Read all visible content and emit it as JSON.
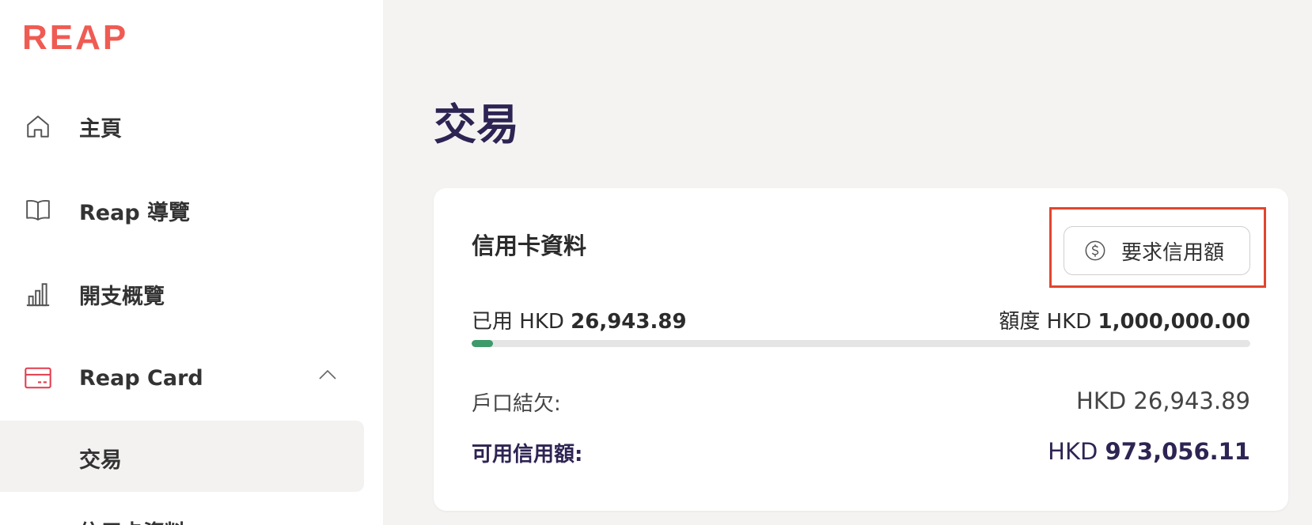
{
  "brand": {
    "logo_text": "REAP",
    "accent_color": "#ef5b52",
    "title_color": "#2e2453"
  },
  "sidebar": {
    "items": [
      {
        "label": "主頁",
        "icon": "home-icon"
      },
      {
        "label": "Reap 導覽",
        "icon": "book-icon"
      },
      {
        "label": "開支概覽",
        "icon": "bar-chart-icon"
      },
      {
        "label": "Reap Card",
        "icon": "credit-card-icon",
        "expanded": true
      }
    ],
    "subitems": [
      {
        "label": "交易",
        "active": true
      },
      {
        "label": "信用卡資料"
      }
    ]
  },
  "page": {
    "title": "交易"
  },
  "card_info": {
    "title": "信用卡資料",
    "request_button_label": "要求信用額",
    "request_button_icon": "dollar-circle-icon",
    "used_prefix": "已用 HKD",
    "used_amount": "26,943.89",
    "limit_prefix": "額度 HKD",
    "limit_amount": "1,000,000.00",
    "usage_fraction": 0.027,
    "account_balance_label": "戶口結欠:",
    "account_balance_value": "HKD 26,943.89",
    "available_credit_label": "可用信用額:",
    "available_credit_prefix": "HKD",
    "available_credit_amount": "973,056.11"
  }
}
